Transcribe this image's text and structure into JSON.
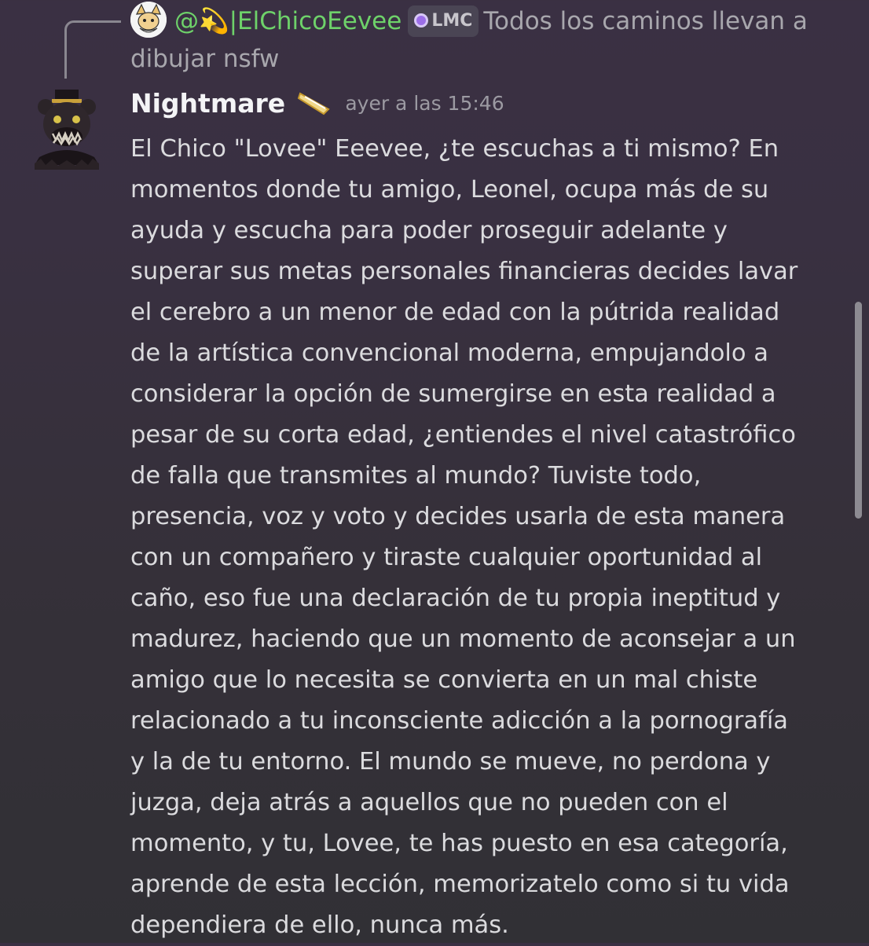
{
  "reply": {
    "mention_prefix": "@💫|",
    "username": "ElChicoEevee",
    "role_tag": "LMC",
    "preview_line1": "Todos los caminos llevan a",
    "preview_line2": "dibujar nsfw",
    "username_color": "#6ed26a"
  },
  "message": {
    "author": "Nightmare",
    "timestamp": "ayer a las 15:46",
    "lines": [
      "El Chico \"Lovee\" Eeevee, ¿te escuchas a ti mismo? En",
      "momentos donde tu amigo, Leonel, ocupa más de su",
      "ayuda y escucha para poder proseguir adelante y",
      "superar sus metas personales financieras decides lavar",
      "el cerebro a un menor de edad con la pútrida realidad",
      "de la artística convencional moderna, empujandolo a",
      "considerar la opción de sumergirse en esta realidad a",
      "pesar de su corta edad, ¿entiendes el nivel catastrófico",
      "de falla que transmites al mundo? Tuviste todo,",
      "presencia, voz y voto y decides usarla de esta manera",
      "con un compañero y tiraste cualquier oportunidad al",
      "caño, eso fue una declaración de tu propia ineptitud y",
      "madurez, haciendo que un momento de aconsejar a un",
      "amigo que lo necesita se convierta en un mal chiste",
      "relacionado a tu inconsciente adicción a la pornografía",
      "y la de tu entorno. El mundo se mueve, no perdona y",
      "juzga, deja atrás a aquellos que no pueden con el",
      "momento, y tu, Lovee, te has puesto en esa categoría,",
      "aprende de esta lección, memorizatelo como si tu vida",
      "dependiera de ello, nunca más."
    ]
  },
  "icons": {
    "reply_avatar": "eevee-avatar-icon",
    "author_avatar": "nightmare-fredbear-avatar-icon",
    "author_badge": "golden-ticket-badge-icon",
    "role_icon": "purple-orb-icon"
  },
  "colors": {
    "background_top": "#3a3043",
    "background_bottom": "#313035",
    "author_name": "#f4f4f6",
    "body_text": "#dbdbde",
    "muted_text": "#a8a7ad"
  }
}
